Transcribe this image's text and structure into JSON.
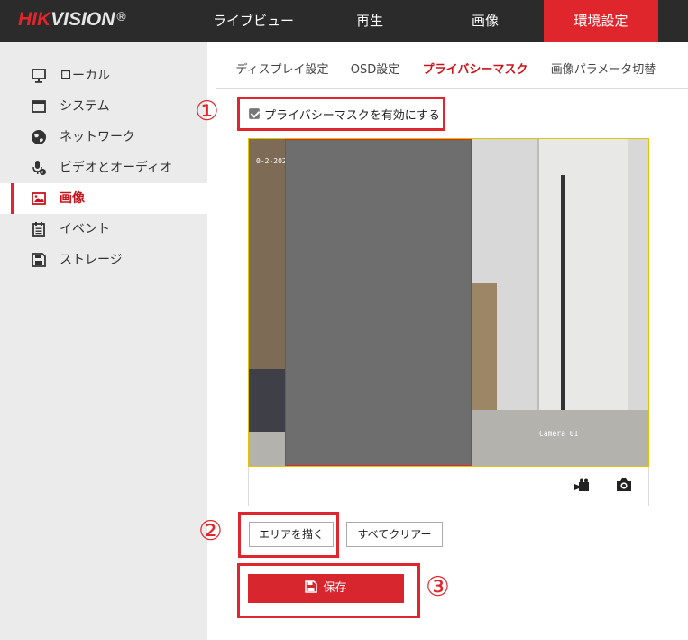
{
  "header": {
    "logo_hik": "HIK",
    "logo_vision": "VISION",
    "logo_reg": "®",
    "nav": [
      "ライブビュー",
      "再生",
      "画像",
      "環境設定"
    ]
  },
  "sidebar": {
    "items": [
      {
        "label": "ローカル",
        "icon": "monitor-icon"
      },
      {
        "label": "システム",
        "icon": "system-window-icon"
      },
      {
        "label": "ネットワーク",
        "icon": "globe-icon"
      },
      {
        "label": "ビデオとオーディオ",
        "icon": "microphone-video-icon"
      },
      {
        "label": "画像",
        "icon": "image-icon",
        "active": true
      },
      {
        "label": "イベント",
        "icon": "calendar-icon"
      },
      {
        "label": "ストレージ",
        "icon": "floppy-disk-icon"
      }
    ]
  },
  "tabs": [
    "ディスプレイ設定",
    "OSD設定",
    "プライバシーマスク",
    "画像パラメータ切替"
  ],
  "active_tab": "プライバシーマスク",
  "privacy": {
    "enable_label": "プライバシーマスクを有効にする",
    "enabled": true
  },
  "video": {
    "osd_time": "0-2-202",
    "osd_camera": "Camera 01"
  },
  "buttons": {
    "draw_area": "エリアを描く",
    "clear_all": "すべてクリアー",
    "save": "保存"
  },
  "step_numbers": [
    "①",
    "②",
    "③"
  ],
  "colors": {
    "accent": "#e0262d",
    "header_bg": "#2b2b2b",
    "sidebar_bg": "#ebebeb",
    "mask_fill": "#6e6e6e"
  }
}
